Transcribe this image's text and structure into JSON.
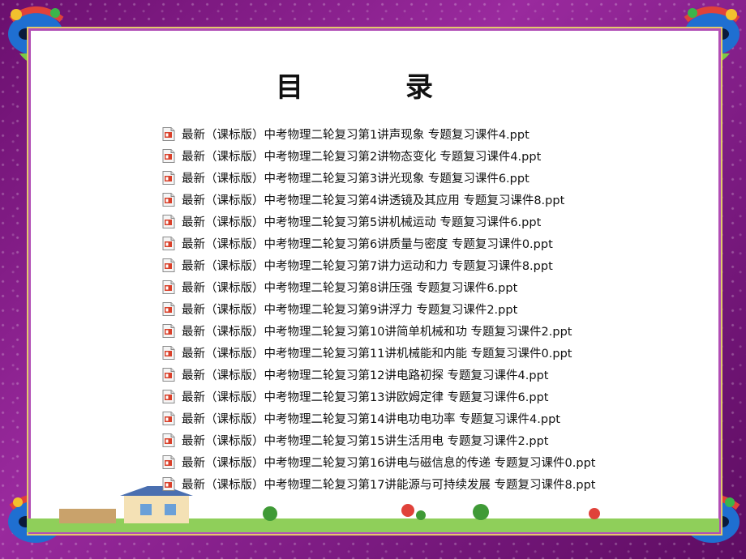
{
  "title": "目　录",
  "items": [
    "最新（课标版）中考物理二轮复习第1讲声现象 专题复习课件4.ppt",
    "最新（课标版）中考物理二轮复习第2讲物态变化 专题复习课件4.ppt",
    "最新（课标版）中考物理二轮复习第3讲光现象 专题复习课件6.ppt",
    "最新（课标版）中考物理二轮复习第4讲透镜及其应用 专题复习课件8.ppt",
    "最新（课标版）中考物理二轮复习第5讲机械运动 专题复习课件6.ppt",
    "最新（课标版）中考物理二轮复习第6讲质量与密度 专题复习课件0.ppt",
    "最新（课标版）中考物理二轮复习第7讲力运动和力 专题复习课件8.ppt",
    "最新（课标版）中考物理二轮复习第8讲压强 专题复习课件6.ppt",
    "最新（课标版）中考物理二轮复习第9讲浮力 专题复习课件2.ppt",
    "最新（课标版）中考物理二轮复习第10讲简单机械和功 专题复习课件2.ppt",
    "最新（课标版）中考物理二轮复习第11讲机械能和内能 专题复习课件0.ppt",
    "最新（课标版）中考物理二轮复习第12讲电路初探 专题复习课件4.ppt",
    "最新（课标版）中考物理二轮复习第13讲欧姆定律 专题复习课件6.ppt",
    "最新（课标版）中考物理二轮复习第14讲电功电功率 专题复习课件4.ppt",
    "最新（课标版）中考物理二轮复习第15讲生活用电 专题复习课件2.ppt",
    "最新（课标版）中考物理二轮复习第16讲电与磁信息的传递 专题复习课件0.ppt",
    "最新（课标版）中考物理二轮复习第17讲能源与可持续发展 专题复习课件8.ppt"
  ],
  "icons": {
    "file": "ppt-file-icon",
    "corner": "carnival-mask-icon"
  },
  "colors": {
    "frame": "#8a2190",
    "paper": "#ffffff",
    "text": "#111111",
    "iconRed": "#d9412b"
  }
}
